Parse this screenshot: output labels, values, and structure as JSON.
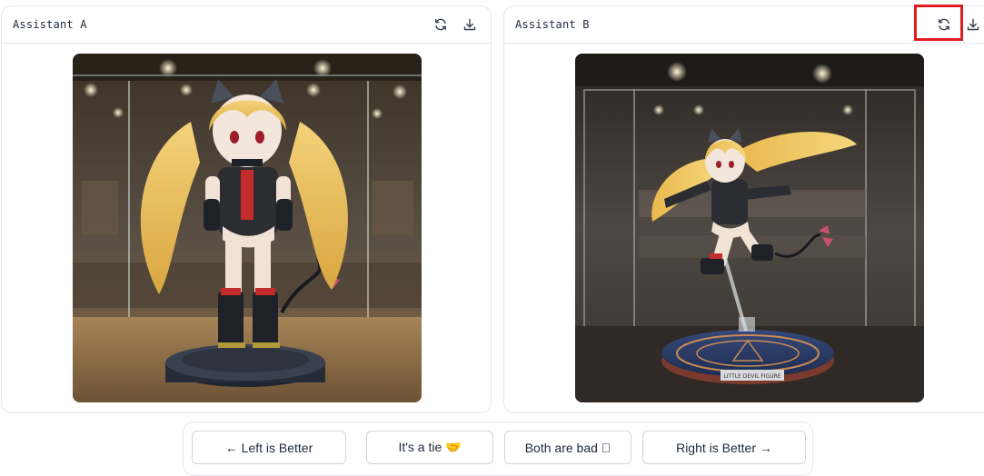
{
  "assistant_a": {
    "title": "Assistant A",
    "image_alt": "Anime figure with blonde twin tails and cat ears standing on a dark base inside a glass display case"
  },
  "assistant_b": {
    "title": "Assistant B",
    "image_alt": "Anime figure with blonde twin tails leaping on a clear stand above a blue magic-circle base inside a glass display case",
    "base_plate_text": "LITTLE DEVIL FIGURE"
  },
  "icons": {
    "regenerate": "refresh-icon",
    "download": "download-icon"
  },
  "vote": {
    "left_better": "← Left is Better",
    "tie": "It's a tie 🤝",
    "both_bad": "Both are bad ⃠",
    "right_better": "Right is Better →"
  },
  "colors": {
    "border": "#e5e7eb",
    "highlight": "#e11d22",
    "text": "#1f2937"
  }
}
